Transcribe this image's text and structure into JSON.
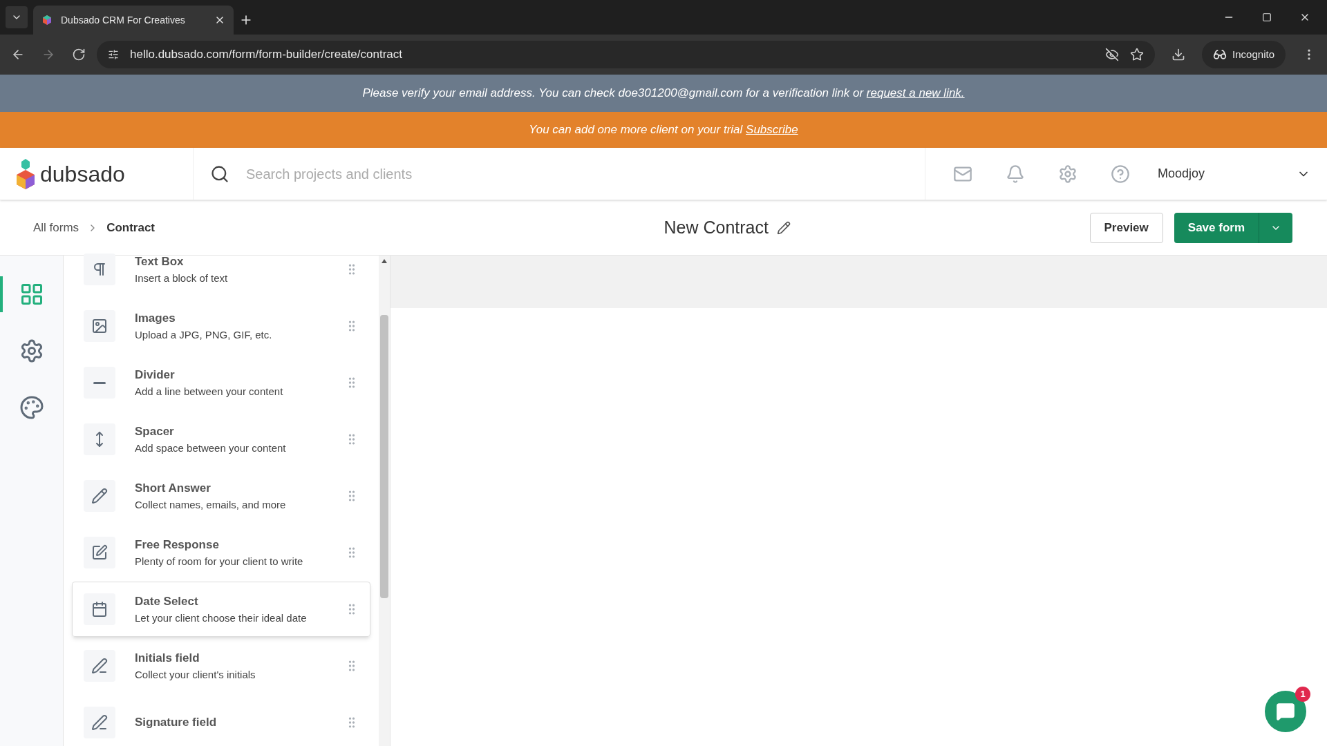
{
  "browser": {
    "tab_title": "Dubsado CRM For Creatives",
    "url": "hello.dubsado.com/form/form-builder/create/contract",
    "profile": "Incognito"
  },
  "verify_banner": {
    "text": "Please verify your email address. You can check doe301200@gmail.com for a verification link or",
    "link": "request a new link."
  },
  "trial_banner": {
    "text": "You can add one more client on your trial",
    "link": "Subscribe"
  },
  "header": {
    "logo": "dubsado",
    "search": {
      "placeholder": "Search projects and clients"
    },
    "user": "Moodjoy"
  },
  "breadcrumb": [
    "All forms",
    "Contract"
  ],
  "form_title": "New Contract",
  "actions": {
    "preview": "Preview",
    "save": "Save form"
  },
  "rail": [
    {
      "selected": true
    },
    {
      "selected": false
    },
    {
      "selected": false
    }
  ],
  "elements": [
    {
      "title": "Text Box",
      "description": "Insert a block of text",
      "highlighted": false
    },
    {
      "title": "Images",
      "description": "Upload a JPG, PNG, GIF, etc.",
      "highlighted": false
    },
    {
      "title": "Divider",
      "description": "Add a line between your content",
      "highlighted": false
    },
    {
      "title": "Spacer",
      "description": "Add space between your content",
      "highlighted": false
    },
    {
      "title": "Short Answer",
      "description": "Collect names, emails, and more",
      "highlighted": false
    },
    {
      "title": "Free Response",
      "description": "Plenty of room for your client to write",
      "highlighted": false
    },
    {
      "title": "Date Select",
      "description": "Let your client choose their ideal date",
      "highlighted": true
    },
    {
      "title": "Initials field",
      "description": "Collect your client's initials",
      "highlighted": false
    },
    {
      "title": "Signature field",
      "highlighted": false
    }
  ],
  "chat": {
    "badge": "1"
  }
}
